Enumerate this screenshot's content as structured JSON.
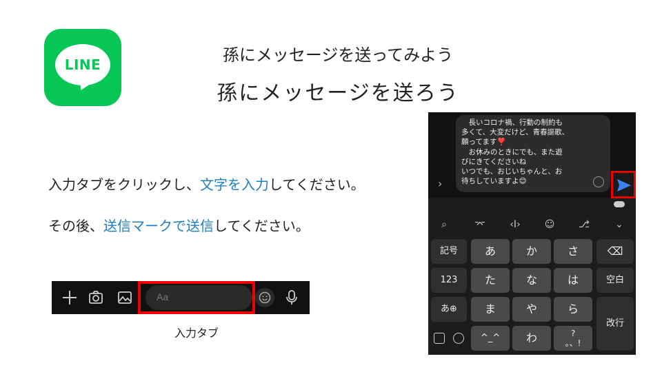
{
  "logo": {
    "text": "LINE",
    "color": "#06c755"
  },
  "title": {
    "line1": "孫にメッセージを送ってみよう",
    "line2": "孫にメッセージを送ろう"
  },
  "instructions": {
    "line1": {
      "pre": "入力タブをクリックし、",
      "highlight": "文字を入力",
      "post": "してください。"
    },
    "line2": {
      "pre": "その後、",
      "highlight": "送信マークで送信",
      "post": "してください。"
    },
    "highlight_color": "#1e7fc0"
  },
  "input_bar": {
    "placeholder": "Aa",
    "icons": [
      "plus-icon",
      "camera-icon",
      "image-icon",
      "emoji-icon",
      "microphone-icon"
    ],
    "caption": "入力タブ"
  },
  "phone": {
    "message": "　長いコロナ禍、行動の制約も\n多くて、大変だけど、青春謳歌、\n願ってます❣️\n　お休みのときにでも、また遊\nびにきてくださいね\nいつでも、おじいちゃんと、お\n待ちしていますよ😊",
    "keyboard": {
      "left_col": [
        "記号",
        "123",
        "あ⊕"
      ],
      "row1": [
        "あ",
        "か",
        "さ"
      ],
      "row2": [
        "た",
        "な",
        "は"
      ],
      "row3": [
        "ま",
        "や",
        "ら"
      ],
      "row4": [
        "^_^",
        "わ",
        "?\n。、!"
      ],
      "right_col": [
        "⌫",
        "空白",
        "改行"
      ]
    },
    "toolbar_icons": [
      "search-icon",
      "shirt-icon",
      "cursor-icon",
      "bear-icon",
      "microphone-icon",
      "chevron-down-icon"
    ]
  },
  "accent": "#e00000"
}
